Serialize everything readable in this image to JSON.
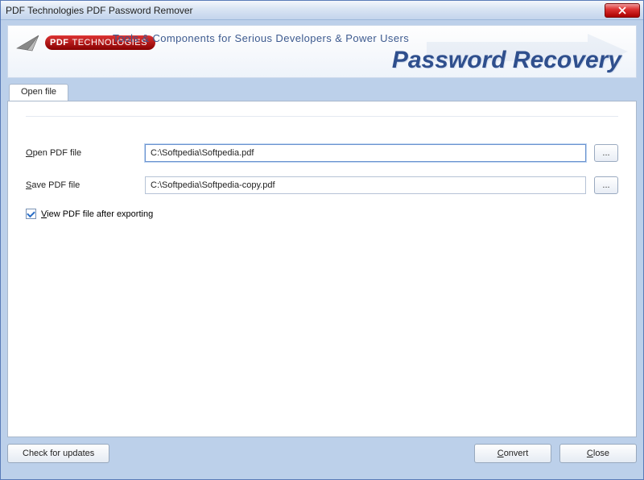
{
  "window": {
    "title": "PDF Technologies PDF Password Remover"
  },
  "banner": {
    "tagline": "Tools & Components for Serious Developers & Power Users",
    "product_title": "Password Recovery",
    "logo_left": "PDF",
    "logo_right": "TECHNOLOGIES"
  },
  "tabs": [
    {
      "label": "Open file"
    }
  ],
  "form": {
    "open_label_prefix": "O",
    "open_label_rest": "pen PDF file",
    "open_value": "C:\\Softpedia\\Softpedia.pdf",
    "save_label_prefix": "S",
    "save_label_rest": "ave PDF file",
    "save_value": "C:\\Softpedia\\Softpedia-copy.pdf",
    "browse_label": "...",
    "view_checked": true,
    "view_label_prefix": "V",
    "view_label_rest": "iew PDF file after exporting"
  },
  "footer": {
    "updates_label": "Check for updates",
    "convert_prefix": "C",
    "convert_rest": "onvert",
    "close_prefix": "C",
    "close_rest": "lose"
  }
}
